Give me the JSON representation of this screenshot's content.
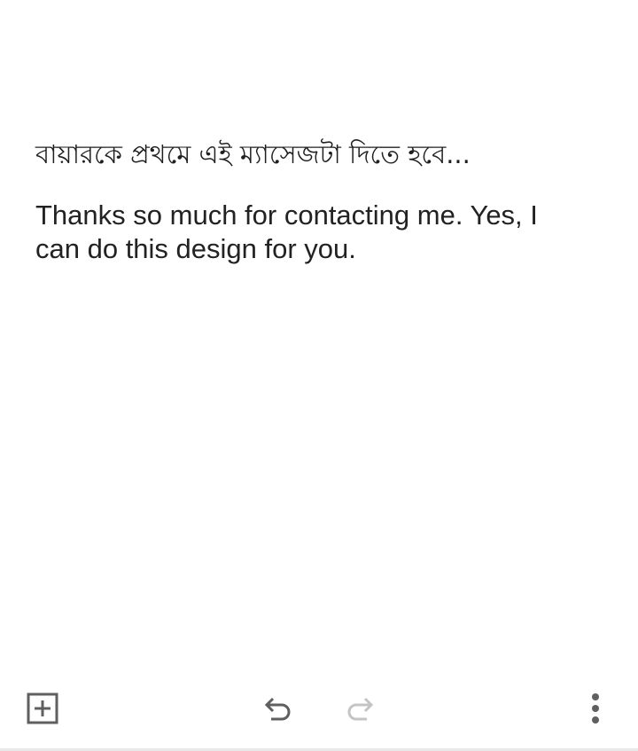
{
  "note": {
    "title": "বায়ারকে প্রথমে এই ম্যাসেজটা দিতে হবে...",
    "body": "Thanks so much for contacting me. Yes, I can do this design for you."
  },
  "toolbar": {
    "add_icon": "add-box-icon",
    "undo_icon": "undo-icon",
    "redo_icon": "redo-icon",
    "more_icon": "more-vertical-icon",
    "active_color": "#5f5f5f",
    "disabled_color": "#c4c4c4"
  }
}
